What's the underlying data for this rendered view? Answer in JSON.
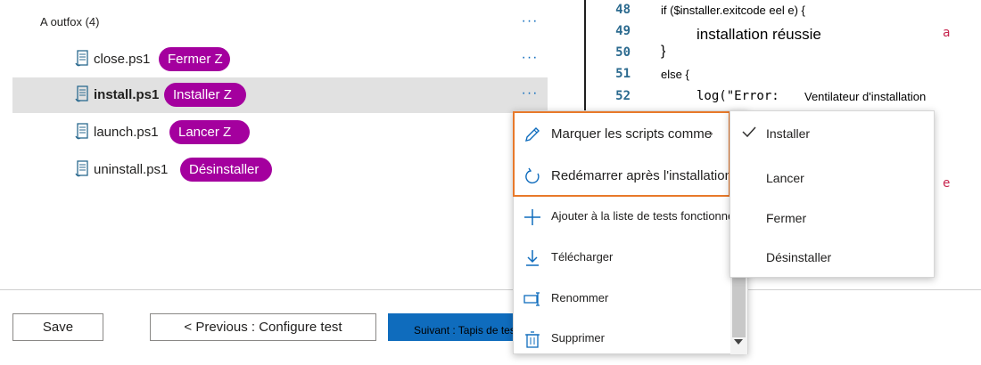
{
  "tree": {
    "group_label": "A outfox (4)",
    "more_glyph": "···",
    "files": [
      {
        "name": "close.ps1",
        "tag": "Fermer Z",
        "selected": false
      },
      {
        "name": "install.ps1",
        "tag": "Installer Z",
        "selected": true
      },
      {
        "name": "launch.ps1",
        "tag": "Lancer Z",
        "selected": false
      },
      {
        "name": "uninstall.ps1",
        "tag": "Désinstaller",
        "selected": false
      }
    ]
  },
  "code": {
    "lines": [
      {
        "num": "48",
        "text": "if ($installer.exitcode eel e) {"
      },
      {
        "num": "49",
        "text": "installation réussie"
      },
      {
        "num": "50",
        "text": "}"
      },
      {
        "num": "51",
        "text": "else {"
      },
      {
        "num": "52",
        "prefix": "log(\"Error:",
        "text": "Ventilateur d'installation"
      }
    ],
    "partial": [
      "a",
      "e"
    ]
  },
  "menu": {
    "items": [
      {
        "label": "Marquer les scripts comme",
        "icon": "pencil-icon"
      },
      {
        "label": "Redémarrer après l'installation",
        "icon": "restart-icon"
      },
      {
        "label": "Ajouter à la liste de tests fonctionnels",
        "icon": "plus-icon"
      },
      {
        "label": "Télécharger",
        "icon": "download-icon"
      },
      {
        "label": "Renommer",
        "icon": "rename-icon"
      },
      {
        "label": "Supprimer",
        "icon": "trash-icon"
      }
    ],
    "highlight_color": "#e8792a"
  },
  "submenu": {
    "items": [
      {
        "label": "Installer",
        "checked": true
      },
      {
        "label": "Lancer",
        "checked": false
      },
      {
        "label": "Fermer",
        "checked": false
      },
      {
        "label": "Désinstaller",
        "checked": false
      }
    ]
  },
  "footer": {
    "save_label": "Save",
    "previous_label": "< Previous : Configure test",
    "next_label": "Suivant : Tapis de test"
  },
  "colors": {
    "accent": "#0f6cbd",
    "tag": "#a4009e",
    "selected_row": "#e1e1e1"
  }
}
